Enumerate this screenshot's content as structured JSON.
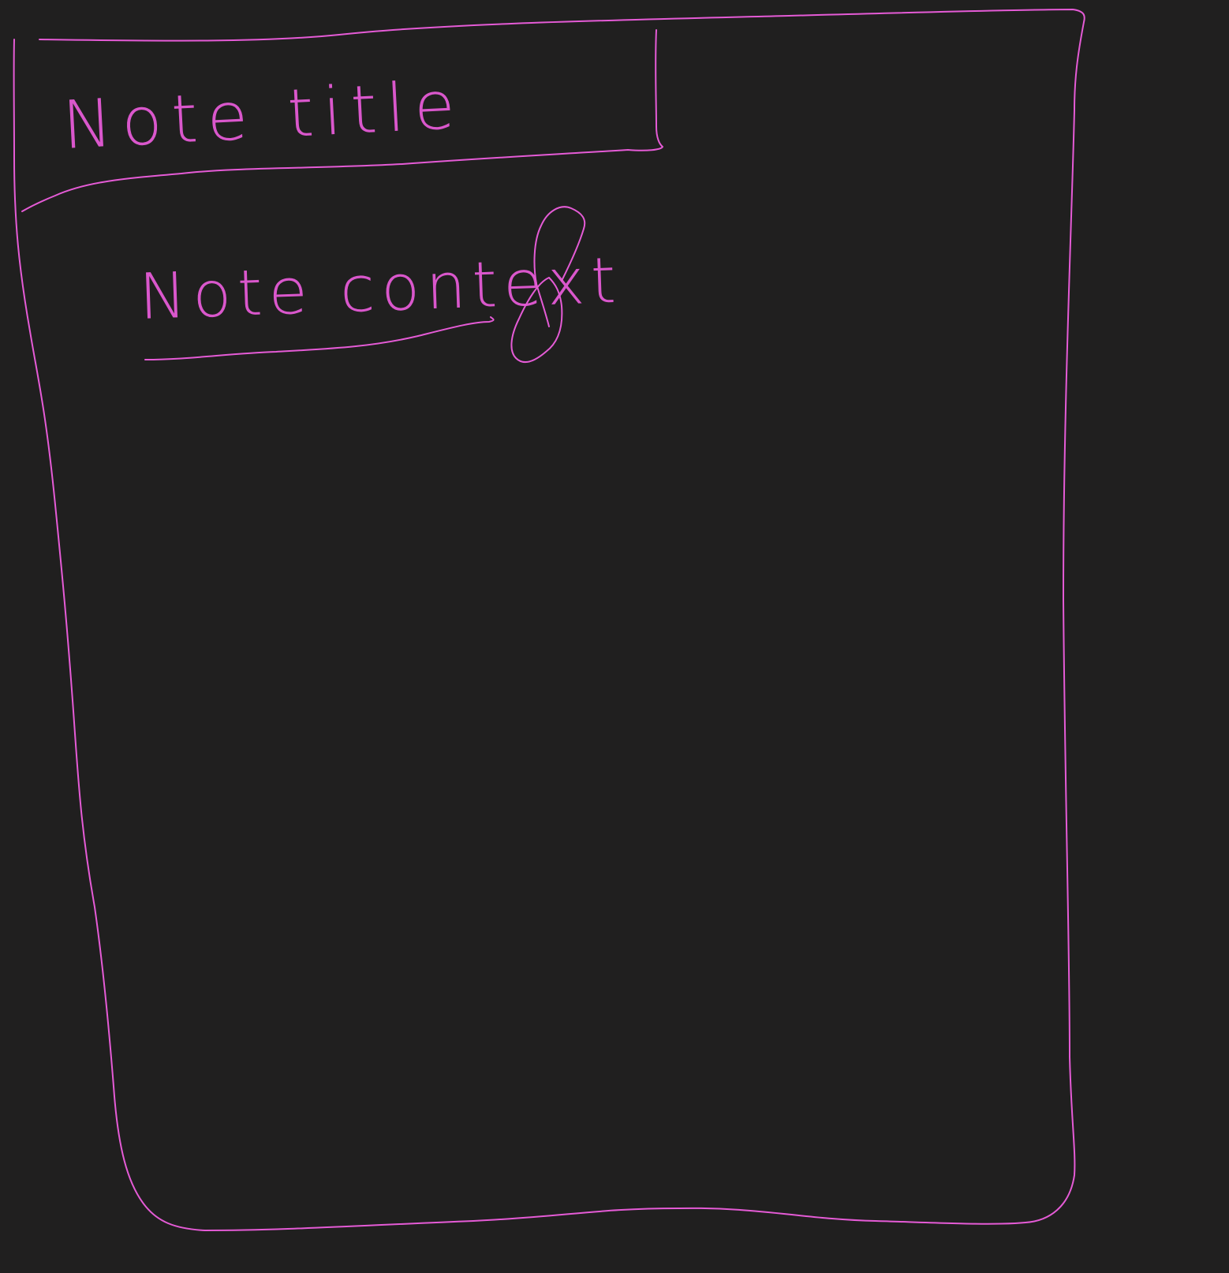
{
  "note_editor": {
    "title_placeholder": "Note title",
    "content_placeholder": "Note context"
  },
  "icons": {
    "attachment": "paperclip-icon"
  },
  "colors": {
    "background": "#201f1f",
    "ink": "#e55bd6"
  }
}
